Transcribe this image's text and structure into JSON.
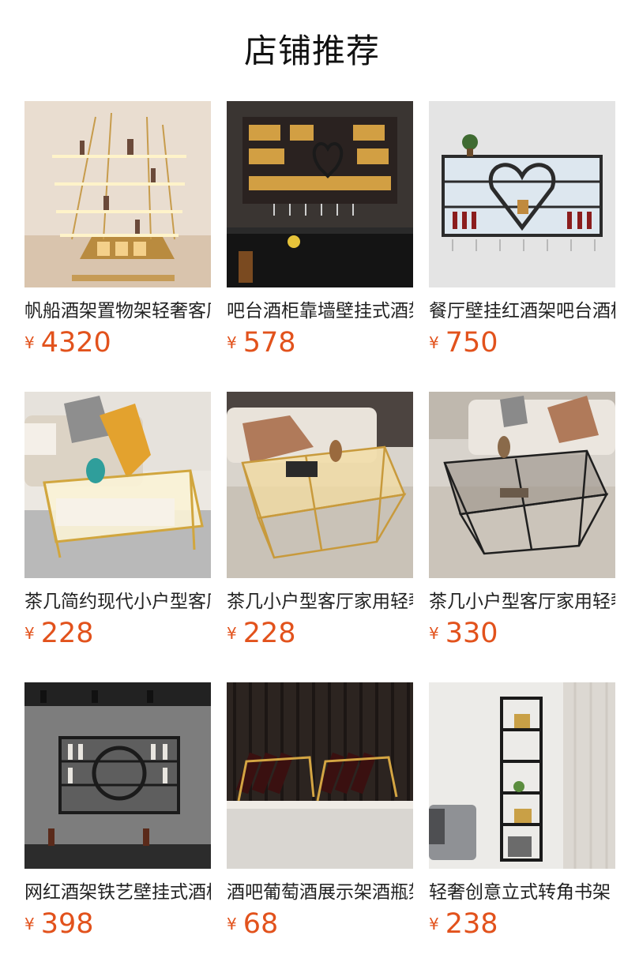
{
  "page": {
    "title": "店铺推荐"
  },
  "currency_symbol": "¥",
  "products": [
    {
      "name": "帆船酒架置物架轻奢客厅",
      "price": "4320",
      "image": "sailboat-wine-rack-image"
    },
    {
      "name": "吧台酒柜靠墙壁挂式酒架",
      "price": "578",
      "image": "bar-wall-wine-cabinet-image"
    },
    {
      "name": "餐厅壁挂红酒架吧台酒柜",
      "price": "750",
      "image": "heart-wall-wine-rack-image"
    },
    {
      "name": "茶几简约现代小户型客厅",
      "price": "228",
      "image": "white-drawer-coffee-table-image"
    },
    {
      "name": "茶几小户型客厅家用轻奢",
      "price": "228",
      "image": "gold-glass-coffee-table-image"
    },
    {
      "name": "茶几小户型客厅家用轻奢",
      "price": "330",
      "image": "black-glass-coffee-table-image"
    },
    {
      "name": "网红酒架铁艺壁挂式酒柜",
      "price": "398",
      "image": "round-wall-wine-rack-image"
    },
    {
      "name": "酒吧葡萄酒展示架酒瓶架",
      "price": "68",
      "image": "tabletop-wine-bottle-rack-image"
    },
    {
      "name": "轻奢创意立式转角书架",
      "price": "238",
      "image": "corner-bookshelf-image"
    }
  ]
}
